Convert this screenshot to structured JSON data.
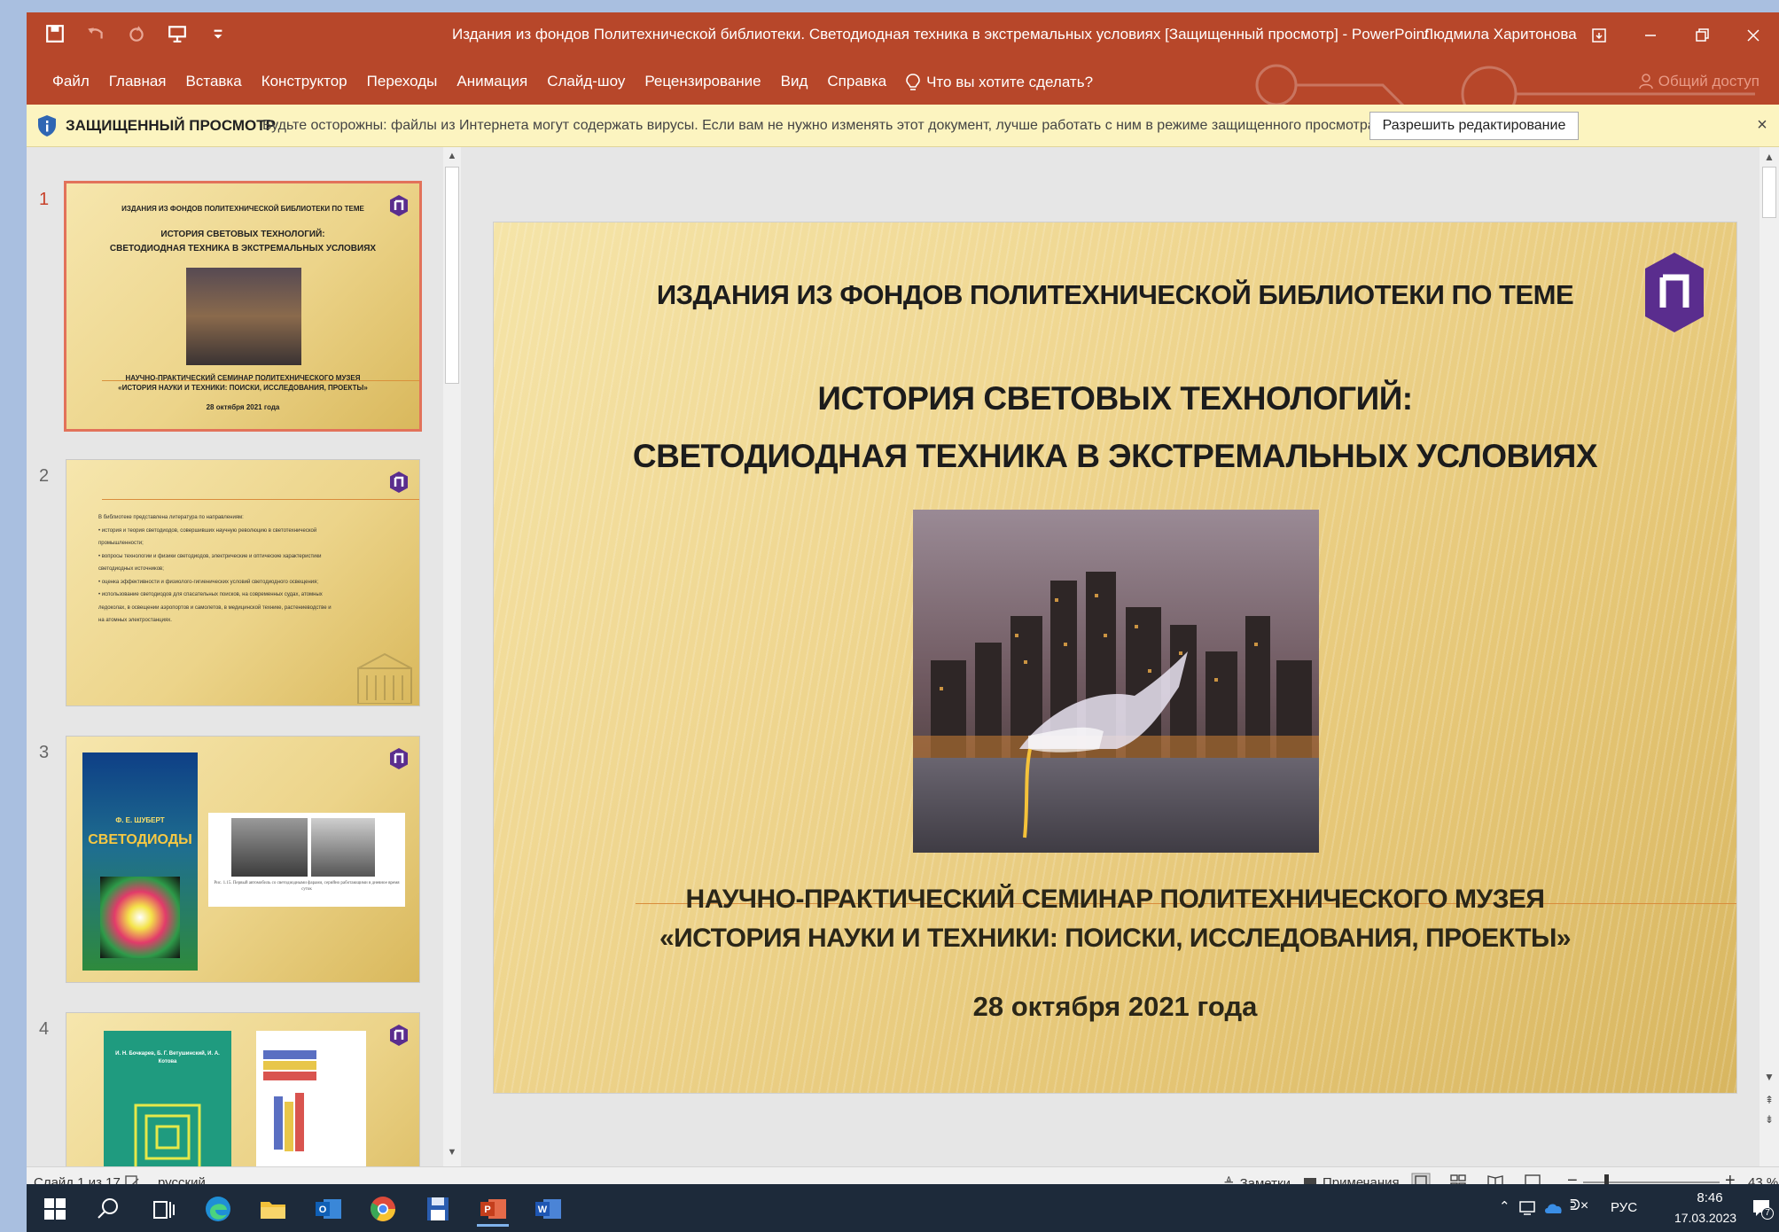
{
  "window": {
    "title": "Издания из фондов Политехнической библиотеки. Светодиодная техника в экстремальных условиях [Защищенный просмотр]  -  PowerPoint",
    "user": "Людмила Харитонова"
  },
  "ribbon": {
    "tabs": [
      "Файл",
      "Главная",
      "Вставка",
      "Конструктор",
      "Переходы",
      "Анимация",
      "Слайд-шоу",
      "Рецензирование",
      "Вид",
      "Справка"
    ],
    "tell_me": "Что вы хотите сделать?",
    "share": "Общий доступ"
  },
  "protected_view": {
    "label": "ЗАЩИЩЕННЫЙ ПРОСМОТР",
    "message": "Будьте осторожны: файлы из Интернета могут содержать вирусы. Если вам не нужно изменять этот документ, лучше работать с ним в режиме защищенного просмотра.",
    "enable_button": "Разрешить редактирование"
  },
  "thumbnails": [
    {
      "number": "1",
      "header": "ИЗДАНИЯ ИЗ ФОНДОВ ПОЛИТЕХНИЧЕСКОЙ БИБЛИОТЕКИ ПО ТЕМЕ",
      "title1": "ИСТОРИЯ СВЕТОВЫХ ТЕХНОЛОГИЙ:",
      "title2": "СВЕТОДИОДНАЯ ТЕХНИКА В ЭКСТРЕМАЛЬНЫХ УСЛОВИЯХ",
      "seminar1": "НАУЧНО-ПРАКТИЧЕСКИЙ СЕМИНАР ПОЛИТЕХНИЧЕСКОГО МУЗЕЯ",
      "seminar2": "«ИСТОРИЯ НАУКИ И ТЕХНИКИ: ПОИСКИ, ИССЛЕДОВАНИЯ, ПРОЕКТЫ»",
      "date": "28 октября 2021 года"
    },
    {
      "number": "2",
      "bullets": [
        "В библиотеке представлена литература по направлениям:",
        "•  история и теория светодиодов, совершивших научную революцию в светотехнической",
        "   промышленности;",
        "•  вопросы технологии и физики светодиодов, электрические и оптические характеристики",
        "   светодиодных источников;",
        "•  оценка эффективности и физиолого-гигиенических условий светодиодного освещения;",
        "•  использование светодиодов для спасательных поисков, на современных судах, атомных",
        "   ледоколах, в освещении аэропортов и самолетов, в медицинской технике, растениеводстве и",
        "   на атомных электростанциях."
      ]
    },
    {
      "number": "3",
      "book_author": "Ф. Е. ШУБЕРТ",
      "book_title": "СВЕТОДИОДЫ",
      "caption": "Рис. 1.15. Первый автомобиль со светодиодными фарами, серийно работающими в дневное время суток"
    },
    {
      "number": "4",
      "book_authors": "И. Н. Бочкарев, Б. Г. Ветушинский, И. А. Котова"
    }
  ],
  "slide": {
    "header": "ИЗДАНИЯ ИЗ ФОНДОВ ПОЛИТЕХНИЧЕСКОЙ БИБЛИОТЕКИ ПО ТЕМЕ",
    "title_line1": "ИСТОРИЯ СВЕТОВЫХ ТЕХНОЛОГИЙ:",
    "title_line2": "СВЕТОДИОДНАЯ ТЕХНИКА В ЭКСТРЕМАЛЬНЫХ УСЛОВИЯХ",
    "seminar_line1": "НАУЧНО-ПРАКТИЧЕСКИЙ СЕМИНАР ПОЛИТЕХНИЧЕСКОГО МУЗЕЯ",
    "seminar_line2": "«ИСТОРИЯ НАУКИ И ТЕХНИКИ: ПОИСКИ, ИССЛЕДОВАНИЯ, ПРОЕКТЫ»",
    "date": "28 октября 2021 года",
    "logo_letter": "П"
  },
  "status": {
    "slide_counter": "Слайд 1 из 17",
    "language": "русский",
    "notes": "Заметки",
    "comments": "Примечания",
    "zoom": "43 %",
    "zoom_fraction": 0.43
  },
  "taskbar": {
    "keyboard_layout": "РУС",
    "time": "8:46",
    "date": "17.03.2023",
    "notifications_count": "7"
  },
  "colors": {
    "accent": "#b7472a",
    "logo_purple": "#5a2d8e",
    "protected_bar": "#fcf4c0"
  },
  "icons": [
    "save-icon",
    "undo-icon",
    "redo-icon",
    "present-icon",
    "lightbulb-icon",
    "person-icon",
    "shield-icon",
    "close-icon",
    "spellcheck-icon",
    "windows-icon",
    "search-icon",
    "taskview-icon",
    "edge-icon",
    "explorer-icon",
    "outlook-icon",
    "chrome-icon",
    "floppy-icon",
    "powerpoint-icon",
    "word-icon"
  ]
}
